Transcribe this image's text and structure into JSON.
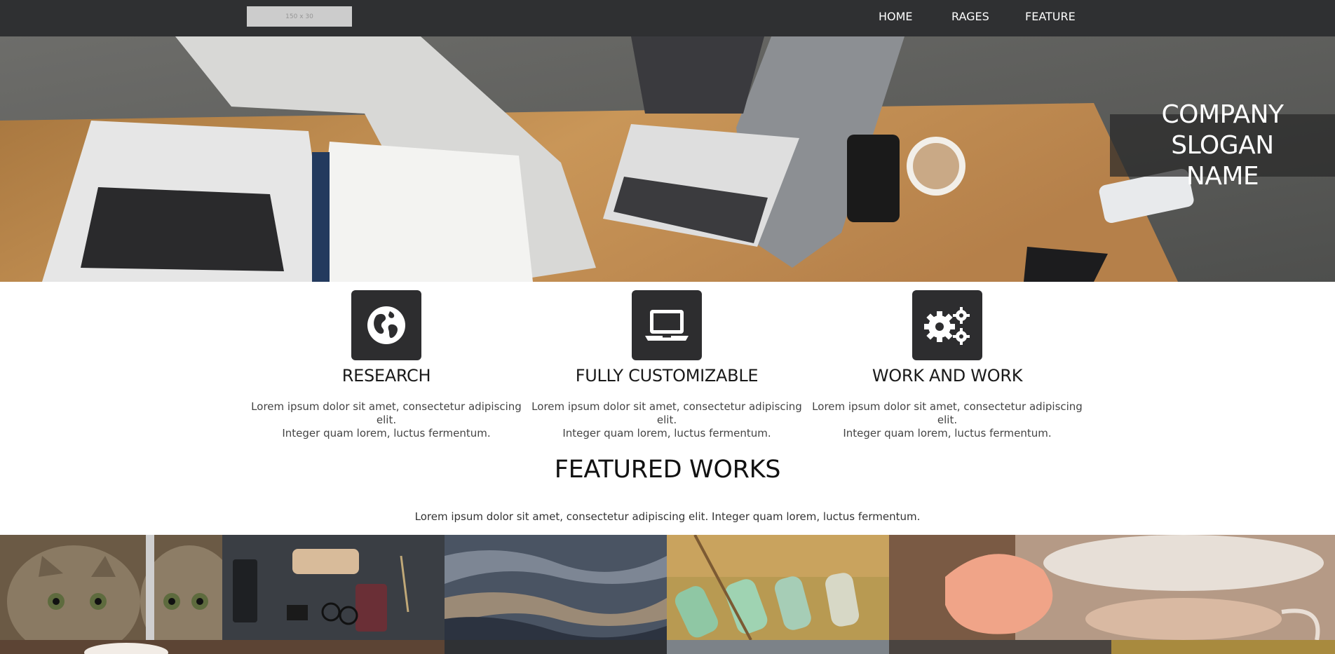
{
  "navbar": {
    "logo_text": "150 x 30",
    "links": [
      "HOME",
      "RAGES",
      "FEATURE"
    ]
  },
  "hero": {
    "slogan_line1": "COMPANY SLOGAN",
    "slogan_line2": "NAME"
  },
  "features": [
    {
      "icon": "globe-icon",
      "title": "RESEARCH",
      "desc_line1": "Lorem ipsum dolor sit amet, consectetur adipiscing elit.",
      "desc_line2": "Integer quam lorem, luctus fermentum."
    },
    {
      "icon": "laptop-icon",
      "title": "FULLY CUSTOMIZABLE",
      "desc_line1": "Lorem ipsum dolor sit amet, consectetur adipiscing elit.",
      "desc_line2": "Integer quam lorem, luctus fermentum."
    },
    {
      "icon": "gears-icon",
      "title": "WORK AND WORK",
      "desc_line1": "Lorem ipsum dolor sit amet, consectetur adipiscing elit.",
      "desc_line2": "Integer quam lorem, luctus fermentum."
    }
  ],
  "featured_works": {
    "title": "FEATURED WORKS",
    "description": "Lorem ipsum dolor sit amet, consectetur adipiscing elit. Integer quam lorem, luctus fermentum."
  },
  "colors": {
    "navbar_bg": "#2f3032",
    "icon_box_bg": "#2d2d2f",
    "slogan_bg": "rgba(40,40,40,0.72)"
  }
}
